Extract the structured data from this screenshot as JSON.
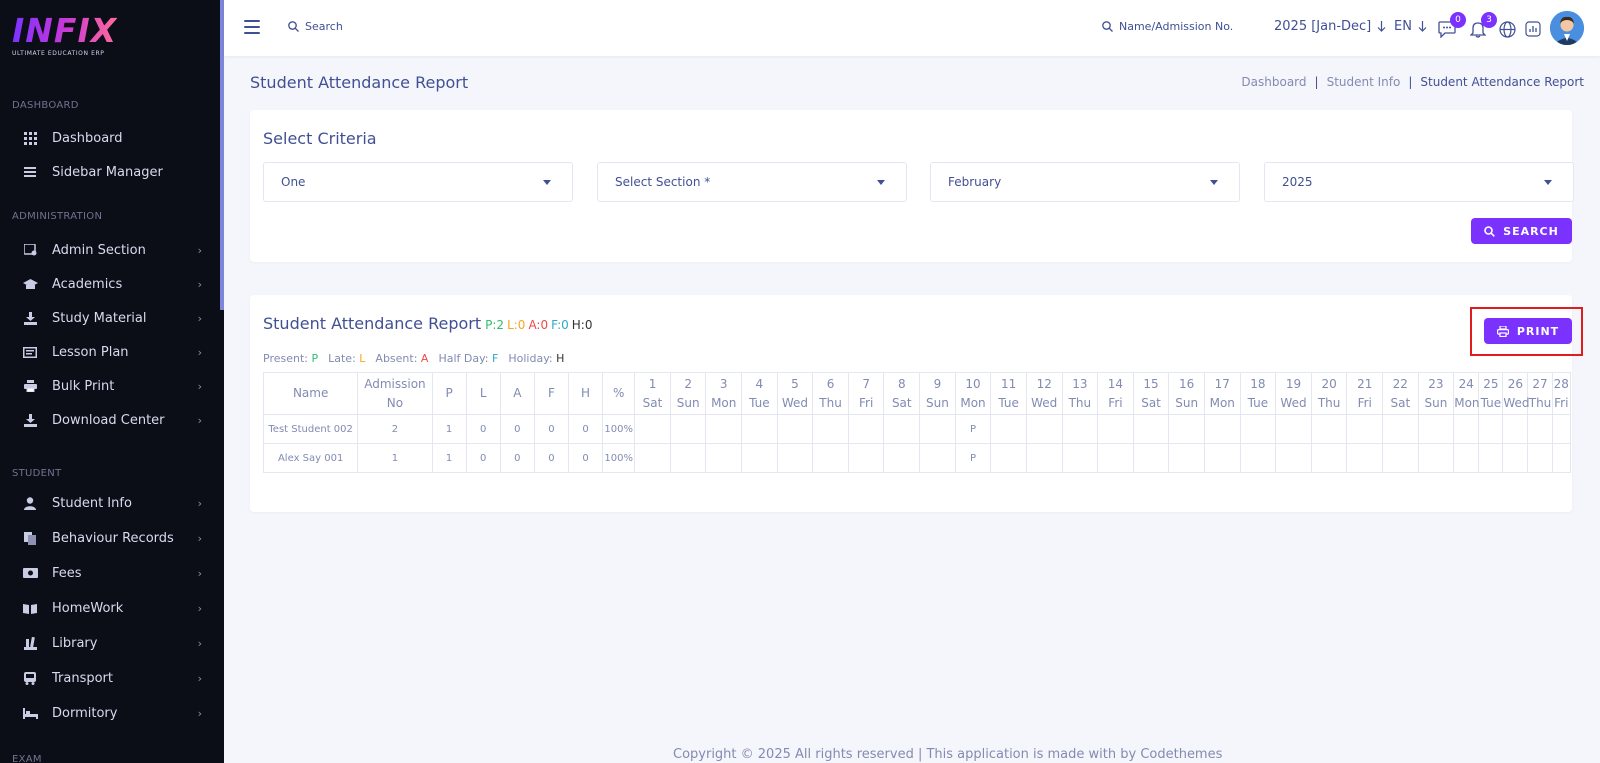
{
  "brand": {
    "logo_text": "INFIX",
    "tagline": "ULTIMATE EDUCATION ERP"
  },
  "sidebar": {
    "sections": [
      {
        "label": "DASHBOARD"
      },
      {
        "label": "ADMINISTRATION"
      },
      {
        "label": "STUDENT"
      },
      {
        "label": "EXAM"
      }
    ],
    "items": [
      {
        "label": "Dashboard",
        "icon": "grid-icon"
      },
      {
        "label": "Sidebar Manager",
        "icon": "list-icon"
      },
      {
        "label": "Admin Section",
        "icon": "admin-icon"
      },
      {
        "label": "Academics",
        "icon": "graduation-cap-icon"
      },
      {
        "label": "Study Material",
        "icon": "download-icon"
      },
      {
        "label": "Lesson Plan",
        "icon": "lesson-icon"
      },
      {
        "label": "Bulk Print",
        "icon": "printer-icon"
      },
      {
        "label": "Download Center",
        "icon": "download-icon"
      },
      {
        "label": "Student Info",
        "icon": "user-icon"
      },
      {
        "label": "Behaviour Records",
        "icon": "records-icon"
      },
      {
        "label": "Fees",
        "icon": "money-icon"
      },
      {
        "label": "HomeWork",
        "icon": "book-icon"
      },
      {
        "label": "Library",
        "icon": "library-icon"
      },
      {
        "label": "Transport",
        "icon": "bus-icon"
      },
      {
        "label": "Dormitory",
        "icon": "bed-icon"
      }
    ]
  },
  "topbar": {
    "search_label": "Search",
    "admission_search_label": "Name/Admission No.",
    "session": "2025 [Jan-Dec]",
    "language": "EN",
    "messages_count": "0",
    "notifications_count": "3"
  },
  "page": {
    "title": "Student Attendance Report",
    "breadcrumb": [
      "Dashboard",
      "Student Info",
      "Student Attendance Report"
    ]
  },
  "criteria": {
    "title": "Select Criteria",
    "class_value": "One",
    "section_placeholder": "Select Section *",
    "month_value": "February",
    "year_value": "2025",
    "search_button": "SEARCH"
  },
  "report": {
    "title": "Student Attendance Report",
    "stats": {
      "p": "P:2",
      "l": "L:0",
      "a": "A:0",
      "f": "F:0",
      "h": "H:0"
    },
    "print_button": "PRINT",
    "legend": {
      "present_label": "Present:",
      "present_code": "P",
      "late_label": "Late:",
      "late_code": "L",
      "absent_label": "Absent:",
      "absent_code": "A",
      "halfday_label": "Half Day:",
      "halfday_code": "F",
      "holiday_label": "Holiday:",
      "holiday_code": "H"
    },
    "headers": {
      "name": "Name",
      "admission": "Admission",
      "admission2": "No",
      "p": "P",
      "l": "L",
      "a": "A",
      "f": "F",
      "h": "H",
      "pct": "%"
    },
    "days": [
      {
        "d": "1",
        "w": "Sat"
      },
      {
        "d": "2",
        "w": "Sun"
      },
      {
        "d": "3",
        "w": "Mon"
      },
      {
        "d": "4",
        "w": "Tue"
      },
      {
        "d": "5",
        "w": "Wed"
      },
      {
        "d": "6",
        "w": "Thu"
      },
      {
        "d": "7",
        "w": "Fri"
      },
      {
        "d": "8",
        "w": "Sat"
      },
      {
        "d": "9",
        "w": "Sun"
      },
      {
        "d": "10",
        "w": "Mon"
      },
      {
        "d": "11",
        "w": "Tue"
      },
      {
        "d": "12",
        "w": "Wed"
      },
      {
        "d": "13",
        "w": "Thu"
      },
      {
        "d": "14",
        "w": "Fri"
      },
      {
        "d": "15",
        "w": "Sat"
      },
      {
        "d": "16",
        "w": "Sun"
      },
      {
        "d": "17",
        "w": "Mon"
      },
      {
        "d": "18",
        "w": "Tue"
      },
      {
        "d": "19",
        "w": "Wed"
      },
      {
        "d": "20",
        "w": "Thu"
      },
      {
        "d": "21",
        "w": "Fri"
      },
      {
        "d": "22",
        "w": "Sat"
      },
      {
        "d": "23",
        "w": "Sun"
      },
      {
        "d": "24",
        "w": "Mon"
      },
      {
        "d": "25",
        "w": "Tue"
      },
      {
        "d": "26",
        "w": "Wed"
      },
      {
        "d": "27",
        "w": "Thu"
      },
      {
        "d": "28",
        "w": "Fri"
      }
    ],
    "rows": [
      {
        "name": "Test Student 002",
        "admission": "2",
        "p": "1",
        "l": "0",
        "a": "0",
        "f": "0",
        "h": "0",
        "pct": "100%",
        "day10": "P"
      },
      {
        "name": "Alex Say 001",
        "admission": "1",
        "p": "1",
        "l": "0",
        "a": "0",
        "f": "0",
        "h": "0",
        "pct": "100%",
        "day10": "P"
      }
    ]
  },
  "footer": "Copyright © 2025 All rights reserved | This application is made with by Codethemes",
  "colors": {
    "accent": "#7c32ff",
    "text": "#415094",
    "muted": "#828bb2",
    "present": "#2fbf71",
    "late": "#f5a623",
    "absent": "#e84a4a",
    "halfday": "#31a9c9"
  }
}
